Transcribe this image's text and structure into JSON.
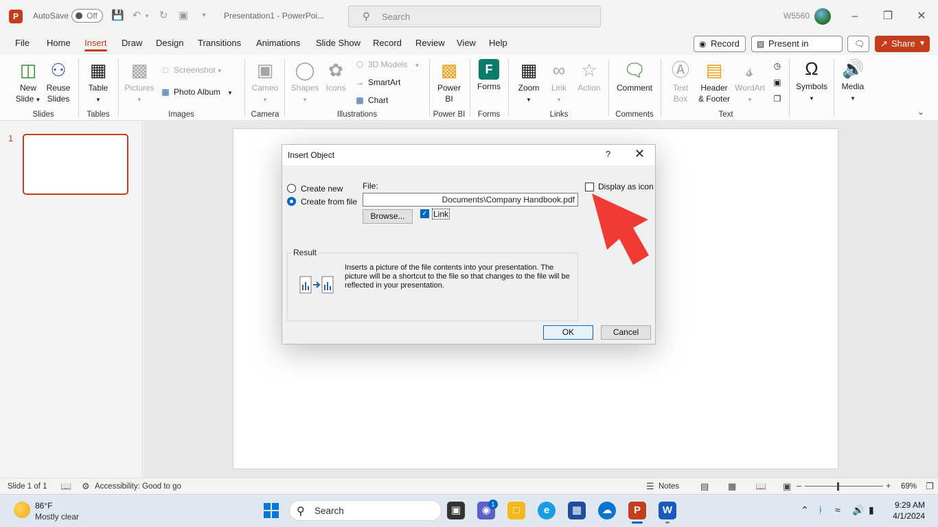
{
  "titlebar": {
    "app_icon": "P",
    "autosave_label": "AutoSave",
    "autosave_state": "Off",
    "doc_title": "Presentation1 - PowerPoi...",
    "search_placeholder": "Search",
    "user": "W5560"
  },
  "tabs": [
    "File",
    "Home",
    "Insert",
    "Draw",
    "Design",
    "Transitions",
    "Animations",
    "Slide Show",
    "Record",
    "Review",
    "View",
    "Help"
  ],
  "header_buttons": {
    "record": "Record",
    "present_in_teams": "Present in Teams",
    "share": "Share"
  },
  "ribbon": {
    "groups": {
      "slides": "Slides",
      "tables": "Tables",
      "images": "Images",
      "camera": "Camera",
      "illustrations": "Illustrations",
      "power_bi": "Power BI",
      "forms": "Forms",
      "links": "Links",
      "comments": "Comments",
      "text": "Text"
    },
    "new_slide": [
      "New",
      "Slide"
    ],
    "reuse_slides": [
      "Reuse",
      "Slides"
    ],
    "table": "Table",
    "pictures": "Pictures",
    "screenshot": "Screenshot",
    "photo_album": "Photo Album",
    "cameo": "Cameo",
    "shapes": "Shapes",
    "icons": "Icons",
    "models_3d": "3D Models",
    "smartart": "SmartArt",
    "chart": "Chart",
    "power_bi": [
      "Power",
      "BI"
    ],
    "forms": "Forms",
    "zoom": "Zoom",
    "link": "Link",
    "action": "Action",
    "comment": "Comment",
    "text_box": [
      "Text",
      "Box"
    ],
    "header_footer": [
      "Header",
      "& Footer"
    ],
    "wordart": "WordArt",
    "symbols": "Symbols",
    "media": "Media"
  },
  "thumbnail": {
    "number": "1"
  },
  "dialog": {
    "title": "Insert Object",
    "help": "?",
    "create_new": "Create new",
    "create_from_file": "Create from file",
    "file_label": "File:",
    "file_path": "Documents\\Company Handbook.pdf",
    "browse": "Browse...",
    "link": "Link",
    "display_as_icon": "Display as icon",
    "result_label": "Result",
    "result_text": "Inserts a picture of the file contents into your presentation. The picture will be a shortcut to the file so that changes to the file will be reflected in your presentation.",
    "ok": "OK",
    "cancel": "Cancel"
  },
  "statusbar": {
    "slide_info": "Slide 1 of 1",
    "accessibility": "Accessibility: Good to go",
    "notes": "Notes",
    "zoom": "69%"
  },
  "taskbar": {
    "temperature": "86°F",
    "condition": "Mostly clear",
    "search": "Search",
    "teams_badge": "1",
    "time": "9:29 AM",
    "date": "4/1/2024"
  },
  "colors": {
    "accent": "#c43e1c",
    "dialog_blue": "#0067c0",
    "annotation_arrow": "#f03a33"
  }
}
